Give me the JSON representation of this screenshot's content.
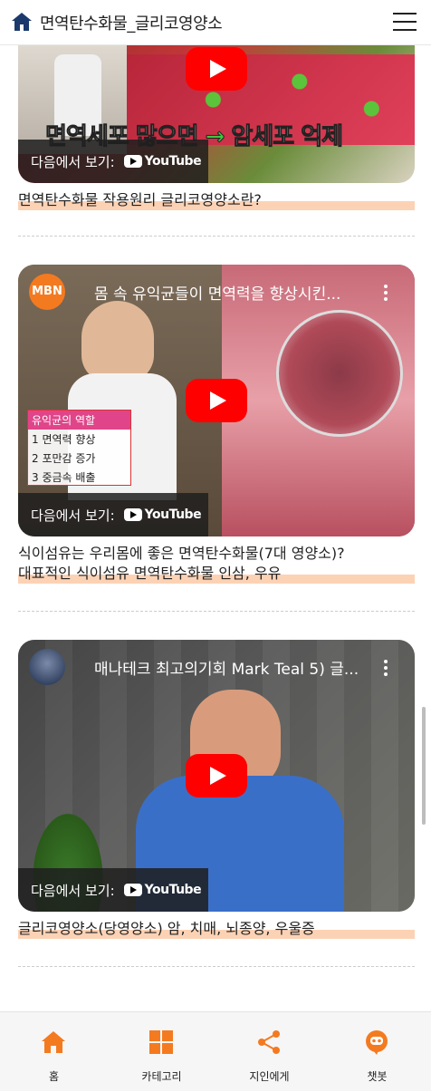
{
  "header": {
    "title": "면역탄수화물_글리코영양소"
  },
  "videos": [
    {
      "watch_label": "다음에서 보기:",
      "youtube_word": "YouTube",
      "overlay_text_1": "면역세포 많으면",
      "overlay_text_2": "암세포 억제",
      "caption": "면역탄수화물 작용원리 글리코영양소란?"
    },
    {
      "channel": "MBN",
      "title": "몸 속 유익균들이 면역력을 향상시킨...",
      "panel_heading": "유익균의 역할",
      "panel_items": [
        "1 면역력 향상",
        "2 포만감 증가",
        "3 중금속 배출"
      ],
      "watch_label": "다음에서 보기:",
      "youtube_word": "YouTube",
      "caption_line1": "식이섬유는 우리몸에 좋은 면역탄수화물(7대 영양소)?",
      "caption_line2": "대표적인 식이섬유 면역탄수화물 인삼, 우유"
    },
    {
      "title": "매나테크 최고의기회 Mark Teal 5) 글...",
      "watch_label": "다음에서 보기:",
      "youtube_word": "YouTube",
      "caption": "글리코영양소(당영양소) 암, 치매, 뇌종양, 우울증"
    }
  ],
  "bottom_nav": [
    {
      "label": "홈",
      "icon": "home-icon"
    },
    {
      "label": "카테고리",
      "icon": "grid-icon"
    },
    {
      "label": "지인에게",
      "icon": "share-icon"
    },
    {
      "label": "챗봇",
      "icon": "chatbot-icon"
    }
  ],
  "colors": {
    "accent": "#f47a20",
    "highlight": "#fcd2b5",
    "header_icon": "#1b3a6b"
  }
}
